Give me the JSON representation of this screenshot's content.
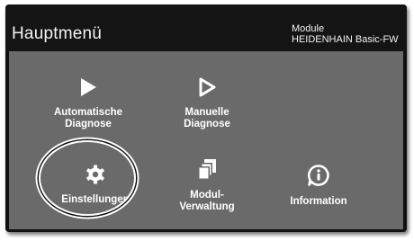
{
  "header": {
    "title": "Hauptmenü",
    "module_label": "Module",
    "module_value": "HEIDENHAIN Basic-FW"
  },
  "menu": {
    "items": [
      {
        "label": "Automatische\nDiagnose",
        "icon": "play-filled-icon"
      },
      {
        "label": "Manuelle\nDiagnose",
        "icon": "play-outline-icon"
      },
      {
        "label": "Einstellungen",
        "icon": "gear-icon",
        "selected": true
      },
      {
        "label": "Modul-\nVerwaltung",
        "icon": "module-stack-icon"
      },
      {
        "label": "Information",
        "icon": "info-bubble-icon"
      }
    ]
  },
  "colors": {
    "frame": "#111111",
    "panel": "#6a6a6a",
    "text": "#ffffff"
  }
}
